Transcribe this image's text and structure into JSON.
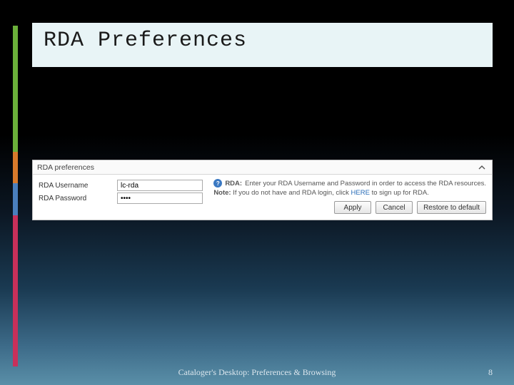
{
  "slide": {
    "title": "RDA Preferences",
    "footer": "Cataloger's Desktop: Preferences & Browsing",
    "page_number": "8"
  },
  "panel": {
    "header": "RDA preferences",
    "fields": {
      "username_label": "RDA Username",
      "username_value": "lc-rda",
      "password_label": "RDA Password",
      "password_value": "••••"
    },
    "info": {
      "prefix_bold": "RDA:",
      "line1": "Enter your RDA Username and Password in order to access the RDA resources.",
      "note_label": "Note:",
      "note_text_1": "If you do not have and RDA login, click",
      "note_link": "HERE",
      "note_text_2": "to sign up for RDA."
    },
    "buttons": {
      "apply": "Apply",
      "cancel": "Cancel",
      "restore": "Restore to default"
    }
  }
}
